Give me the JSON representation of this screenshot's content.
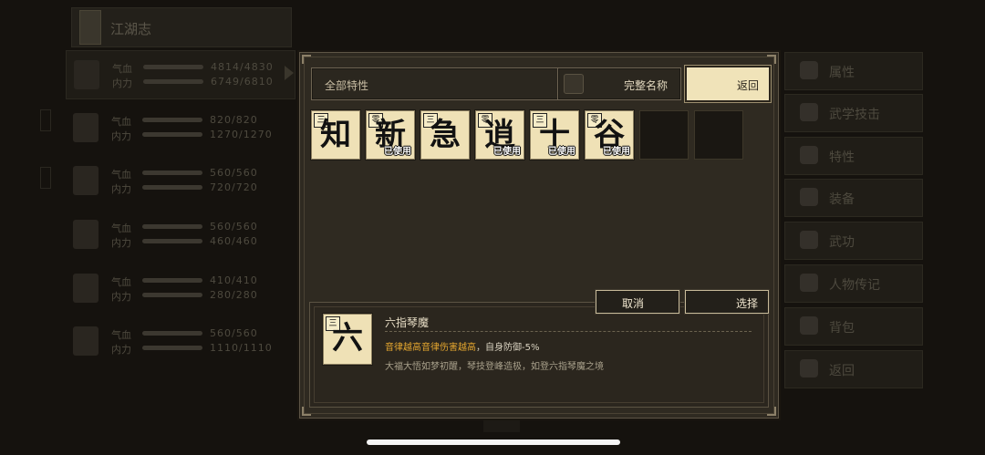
{
  "background": {
    "title": "江湖志",
    "characters": [
      {
        "qi_label": "气血",
        "qi": "4814/4830",
        "neili_label": "内力",
        "neili": "6749/6810"
      },
      {
        "qi_label": "气血",
        "qi": "820/820",
        "neili_label": "内力",
        "neili": "1270/1270"
      },
      {
        "qi_label": "气血",
        "qi": "560/560",
        "neili_label": "内力",
        "neili": "720/720"
      },
      {
        "qi_label": "气血",
        "qi": "560/560",
        "neili_label": "内力",
        "neili": "460/460"
      },
      {
        "qi_label": "气血",
        "qi": "410/410",
        "neili_label": "内力",
        "neili": "280/280"
      },
      {
        "qi_label": "气血",
        "qi": "560/560",
        "neili_label": "内力",
        "neili": "1110/1110"
      }
    ],
    "menu": [
      {
        "label": "属性",
        "icon": "person-icon"
      },
      {
        "label": "武学技击",
        "icon": "martial-icon"
      },
      {
        "label": "特性",
        "icon": "trait-icon"
      },
      {
        "label": "装备",
        "icon": "sword-icon"
      },
      {
        "label": "武功",
        "icon": "scroll-icon"
      },
      {
        "label": "人物传记",
        "icon": "book-icon"
      },
      {
        "label": "背包",
        "icon": "bag-icon"
      },
      {
        "label": "返回",
        "icon": "door-icon"
      }
    ]
  },
  "dialog": {
    "filter_label": "全部特性",
    "fullname_label": "完整名称",
    "back_label": "返回",
    "cards": [
      {
        "rank": "三",
        "char": "知",
        "used": ""
      },
      {
        "rank": "零",
        "char": "新",
        "used": "已使用"
      },
      {
        "rank": "三",
        "char": "急",
        "used": ""
      },
      {
        "rank": "零",
        "char": "逍",
        "used": "已使用"
      },
      {
        "rank": "三",
        "char": "十",
        "used": "已使用"
      },
      {
        "rank": "零",
        "char": "谷",
        "used": "已使用"
      }
    ],
    "cancel_label": "取消",
    "select_label": "选择",
    "detail": {
      "rank": "三",
      "char": "六",
      "name": "六指琴魔",
      "effect_highlight": "音律越高音律伤害越高",
      "effect_rest": "，自身防御-5%",
      "description": "大福大悟如梦初醒，琴技登峰造极，如登六指琴魔之境"
    }
  },
  "colors": {
    "card_bg": "#efe1b6",
    "highlight": "#e5a72f",
    "dialog_bg": "#2f2a21"
  }
}
